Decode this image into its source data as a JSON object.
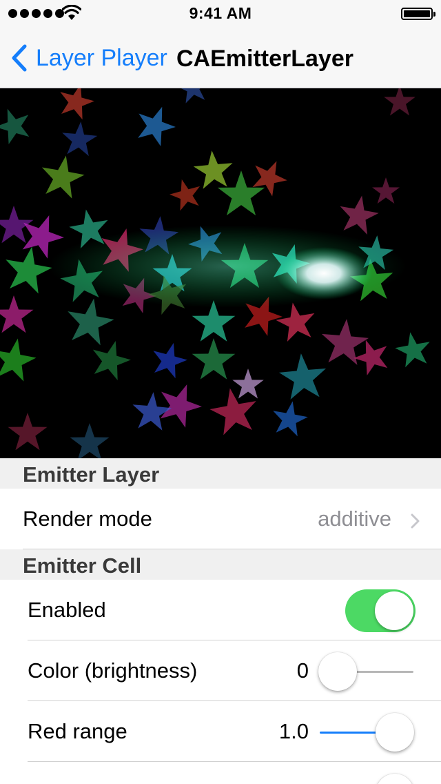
{
  "status_bar": {
    "time": "9:41 AM",
    "signal_icon": "signal-dots-icon",
    "wifi_icon": "wifi-icon",
    "battery_icon": "battery-icon",
    "battery_level": 1.0
  },
  "nav": {
    "back_label": "Layer Player",
    "back_icon": "chevron-left-icon",
    "title": "CAEmitterLayer",
    "accent_color": "#157efb"
  },
  "emitter_preview": {
    "particle_shape": "star-icon",
    "background_color": "#000000"
  },
  "sections": {
    "emitter_layer": {
      "header": "Emitter Layer",
      "render_mode_label": "Render mode",
      "render_mode_value": "additive",
      "disclosure_icon": "chevron-right-icon"
    },
    "emitter_cell": {
      "header": "Emitter Cell",
      "enabled_label": "Enabled",
      "enabled_on": true,
      "toggle_color": "#4cd964",
      "color_brightness_label": "Color (brightness)",
      "color_brightness_value": "0",
      "color_brightness_fraction": 0.0,
      "red_range_label": "Red range",
      "red_range_value": "1.0",
      "red_range_fraction": 1.0
    }
  }
}
